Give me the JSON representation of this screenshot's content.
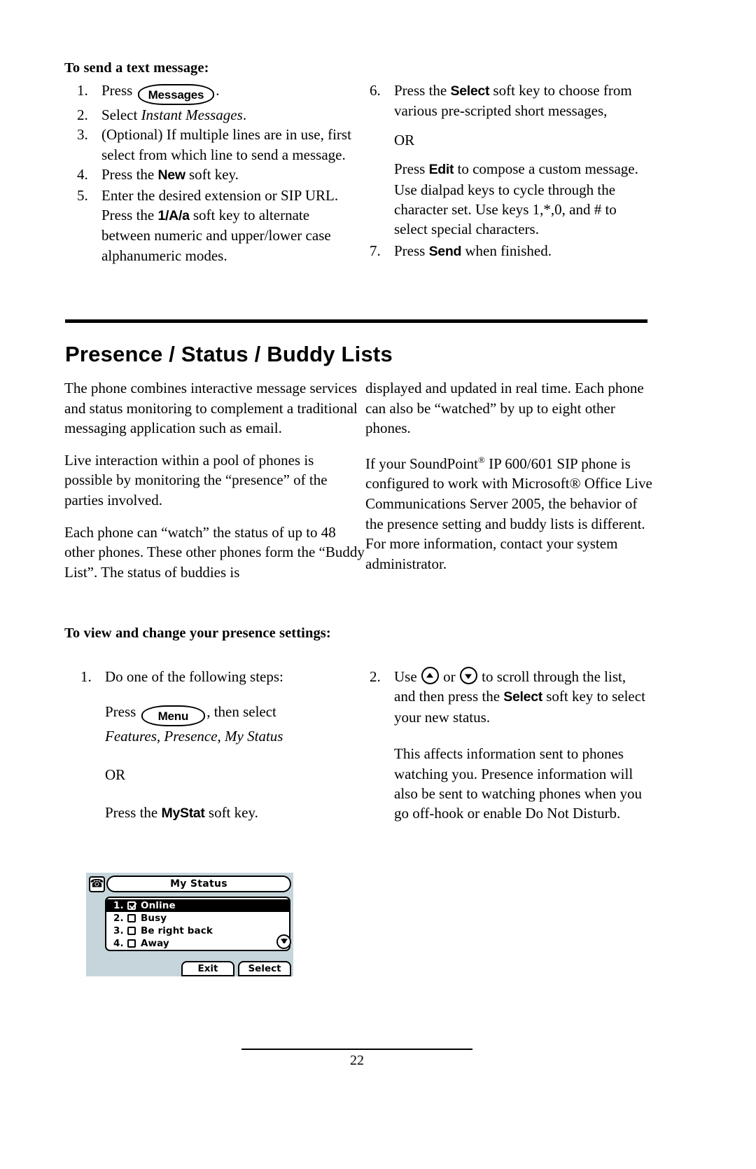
{
  "document": {
    "page_number": "22"
  },
  "section_text_message": {
    "heading": "To send a text message:",
    "left_steps": [
      {
        "num": "1.",
        "pre": "Press ",
        "key": "Messages",
        "post": "."
      },
      {
        "num": "2.",
        "pre": "Select ",
        "italic": "Instant Messages",
        "post": "."
      },
      {
        "num": "3.",
        "text": "(Optional)  If multiple lines are in use, first select from which line to send a message."
      },
      {
        "num": "4.",
        "pre": "Press the ",
        "softkey": "New",
        "post": " soft key."
      },
      {
        "num": "5.",
        "pre": "Enter the desired extension or SIP URL.  Press the ",
        "softkey": "1/A/a",
        "post": " soft key to alternate between numeric and upper/lower case alphanumeric modes."
      }
    ],
    "right_steps": [
      {
        "num": "6.",
        "pre": "Press the ",
        "softkey": "Select",
        "post": " soft key to choose from various pre-scripted short messages,"
      },
      {
        "or": "OR"
      },
      {
        "pre": "Press ",
        "softkey": "Edit",
        "post": " to compose a custom message.  Use dialpad keys to cycle through the character set.  Use keys 1,*,0, and # to select special characters."
      },
      {
        "num": "7.",
        "pre": "Press ",
        "softkey": "Send",
        "post": " when finished."
      }
    ]
  },
  "section_presence": {
    "heading": "Presence / Status / Buddy Lists",
    "left_paragraphs": [
      "The phone combines interactive message services and status monitoring to complement a traditional messaging application such as email.",
      "Live interaction within a pool of phones is possible by monitoring the “presence” of the parties involved.",
      "Each phone can “watch” the status of up to 48 other phones.  These other phones form the “Buddy List”.  The status of buddies is"
    ],
    "right_paragraph_1": "displayed and updated in real time.  Each phone can also be “watched” by up to eight other phones.",
    "right_paragraph_2_a": "If your SoundPoint",
    "right_paragraph_2_reg": "®",
    "right_paragraph_2_b": " IP 600/601 SIP phone is configured to work with Microsoft® Office Live Communications Server 2005, the behavior of the presence setting and buddy lists is different.  For more information, contact your system administrator."
  },
  "section_presence_settings": {
    "heading": "To view and change your presence settings:",
    "step_1_num": "1.",
    "step_1_text": "Do one of the following steps:",
    "step_1_press": "Press",
    "step_1_key": "Menu",
    "step_1_then": ", then select",
    "step_1_path": "Features, Presence, My Status",
    "step_1_or": "OR",
    "step_1_alt_pre": "Press the ",
    "step_1_alt_softkey": "MyStat",
    "step_1_alt_post": " soft key.",
    "step_2_num": "2.",
    "step_2_pre": "Use ",
    "step_2_mid": " or ",
    "step_2_post": " to scroll through the list, and then press the ",
    "step_2_softkey": "Select",
    "step_2_tail": " soft key to select your new status.",
    "step_2_para": "This affects information sent to phones watching you.  Presence information will also be sent to watching phones when you go off-hook or enable Do Not Disturb."
  },
  "phone_screen": {
    "title": "My Status",
    "phone_icon": "telephone-icon",
    "rows": [
      {
        "index": "1.",
        "label": "Online",
        "checked": true,
        "selected": true
      },
      {
        "index": "2.",
        "label": "Busy",
        "checked": false,
        "selected": false
      },
      {
        "index": "3.",
        "label": "Be right back",
        "checked": false,
        "selected": false
      },
      {
        "index": "4.",
        "label": "Away",
        "checked": false,
        "selected": false
      }
    ],
    "softkeys": [
      "Exit",
      "Select"
    ],
    "scroll_indicator": "scroll-down-icon",
    "background_color": "#c5d5db"
  }
}
